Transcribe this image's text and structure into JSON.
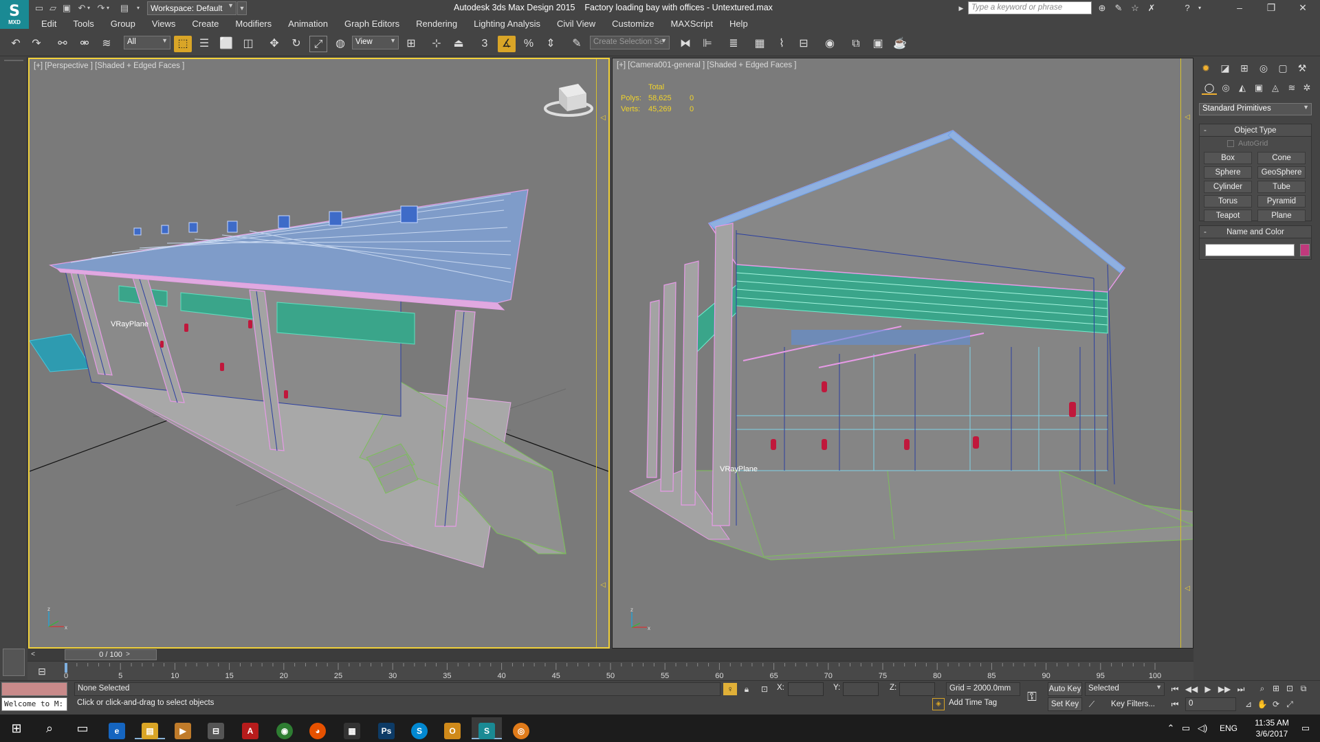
{
  "window": {
    "title": "Autodesk 3ds Max Design 2015    Factory loading bay with offices - Untextured.max",
    "logo": "MXD",
    "workspace": "Workspace: Default",
    "search_placeholder": "Type a keyword or phrase"
  },
  "menu": [
    "Edit",
    "Tools",
    "Group",
    "Views",
    "Create",
    "Modifiers",
    "Animation",
    "Graph Editors",
    "Rendering",
    "Lighting Analysis",
    "Civil View",
    "Customize",
    "MAXScript",
    "Help"
  ],
  "toolbar": {
    "selection_filter": "All",
    "reference_coord": "View",
    "snap_label": "3",
    "selection_set_placeholder": "Create Selection Se"
  },
  "viewports": {
    "left": {
      "label": "[+] [Perspective ] [Shaded + Edged Faces ]",
      "object_label": "VRayPlane"
    },
    "right": {
      "label": "[+] [Camera001-general ] [Shaded + Edged Faces ]",
      "object_label": "VRayPlane",
      "stats": {
        "header": "Total",
        "polys_label": "Polys:",
        "polys_value": "58,625",
        "polys_sel": "0",
        "verts_label": "Verts:",
        "verts_value": "45,269",
        "verts_sel": "0"
      }
    }
  },
  "command_panel": {
    "category": "Standard Primitives",
    "object_type_title": "Object Type",
    "autogrid_label": "AutoGrid",
    "primitives": [
      "Box",
      "Cone",
      "Sphere",
      "GeoSphere",
      "Cylinder",
      "Tube",
      "Torus",
      "Pyramid",
      "Teapot",
      "Plane"
    ],
    "name_color_title": "Name and Color",
    "object_color": "#c0397c"
  },
  "timeline": {
    "frame_display": "0 / 100",
    "ticks": [
      "0",
      "5",
      "10",
      "15",
      "20",
      "25",
      "30",
      "35",
      "40",
      "45",
      "50",
      "55",
      "60",
      "65",
      "70",
      "75",
      "80",
      "85",
      "90",
      "95",
      "100"
    ]
  },
  "status": {
    "listener_text": "Welcome to M:",
    "selection": "None Selected",
    "prompt": "Click or click-and-drag to select objects",
    "x_label": "X:",
    "y_label": "Y:",
    "z_label": "Z:",
    "grid": "Grid = 2000.0mm",
    "add_time_tag": "Add Time Tag",
    "auto_key": "Auto Key",
    "set_key": "Set Key",
    "key_mode": "Selected",
    "key_filters": "Key Filters...",
    "current_frame": "0"
  },
  "taskbar": {
    "language": "ENG",
    "time": "11:35 AM",
    "date": "3/6/2017"
  }
}
